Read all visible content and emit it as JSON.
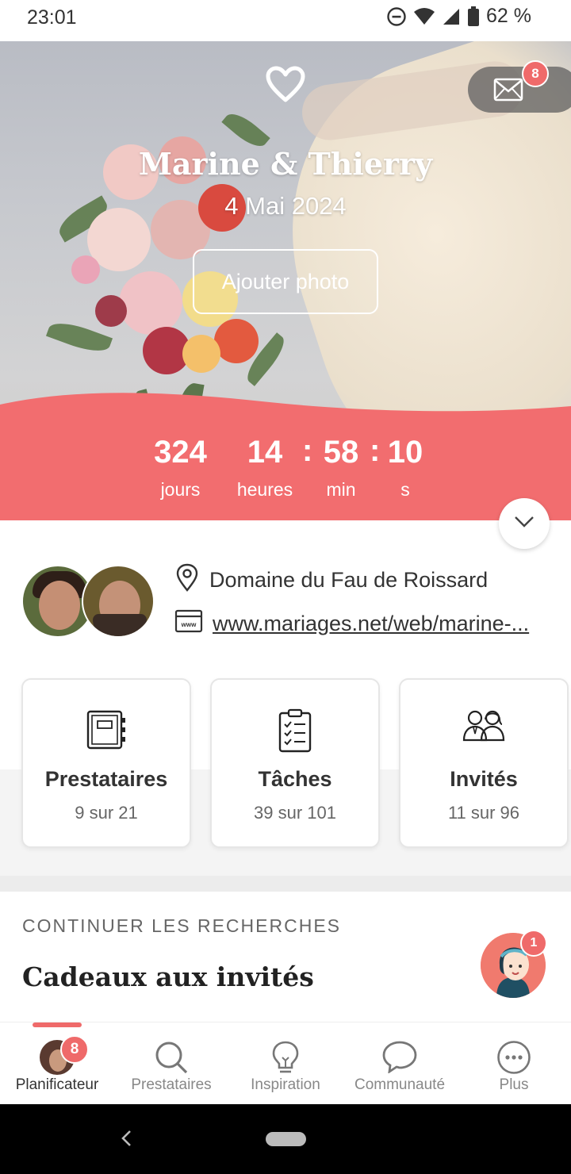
{
  "status_bar": {
    "time": "23:01",
    "battery_percent": "62 %",
    "icons": [
      "do-not-disturb-icon",
      "wifi-icon",
      "signal-icon",
      "battery-icon"
    ]
  },
  "hero": {
    "couple_names": "Marine & Thierry",
    "wedding_date": "4 Mai 2024",
    "add_photo_label": "Ajouter photo",
    "messages_badge": "8"
  },
  "countdown": {
    "days_value": "324",
    "days_label": "jours",
    "hours_value": "14",
    "hours_label": "heures",
    "minutes_value": "58",
    "minutes_label": "min",
    "seconds_value": "10",
    "seconds_label": "s",
    "separator": ":"
  },
  "info": {
    "venue": "Domaine du Fau de Roissard",
    "website": "www.mariages.net/web/marine-..."
  },
  "cards": [
    {
      "title": "Prestataires",
      "progress": "9 sur 21",
      "icon": "notebook-icon"
    },
    {
      "title": "Tâches",
      "progress": "39 sur 101",
      "icon": "checklist-icon"
    },
    {
      "title": "Invités",
      "progress": "11 sur 96",
      "icon": "guests-icon"
    }
  ],
  "continue_searching": {
    "label": "CONTINUER LES RECHERCHES",
    "title": "Cadeaux aux invités",
    "assistant_badge": "1"
  },
  "bottom_nav": {
    "items": [
      {
        "label": "Planificateur",
        "badge": "8",
        "active": true
      },
      {
        "label": "Prestataires"
      },
      {
        "label": "Inspiration"
      },
      {
        "label": "Communauté"
      },
      {
        "label": "Plus"
      }
    ]
  },
  "colors": {
    "accent": "#f26d6f",
    "badge": "#ef6a6a",
    "text": "#333333"
  }
}
